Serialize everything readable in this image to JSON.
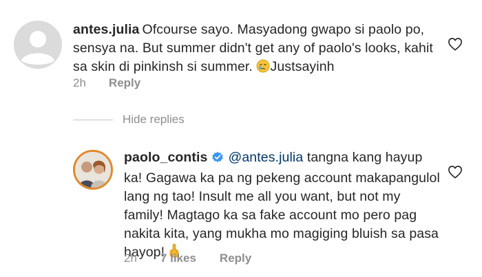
{
  "comment1": {
    "username": "antes.julia",
    "text_line1": "Ofcourse sayo. Masyadong gwapo si paolo po,",
    "text_line2": "sensya na. But summer didn't get any of paolo's looks, kahit",
    "text_line3": "sa skin di pinkinsh si summer.",
    "text_line3_end": "Justsayinh",
    "emoji": "crying-face",
    "time": "2h",
    "reply_label": "Reply"
  },
  "hide_replies_label": "Hide replies",
  "comment2": {
    "username": "paolo_contis",
    "verified": true,
    "mention": "@antes.julia",
    "text_line1": "tangna kang hayup",
    "text_line2": "ka! Gagawa ka pa ng pekeng account makapangulol",
    "text_line3": "lang ng tao! Insult me all you want, but not my",
    "text_line4": "family! Magtago ka sa fake account mo pero pag",
    "text_line5": "nakita kita, yang mukha mo magiging bluish sa pasa",
    "text_line6": "hayop!",
    "emoji": "middle-finger",
    "time": "2h",
    "likes": "7 likes",
    "reply_label": "Reply"
  },
  "colors": {
    "text": "#262626",
    "muted": "#8e8e8e",
    "mention": "#00376b",
    "verified": "#3897f0",
    "avatar_ring": "#e0892a"
  }
}
